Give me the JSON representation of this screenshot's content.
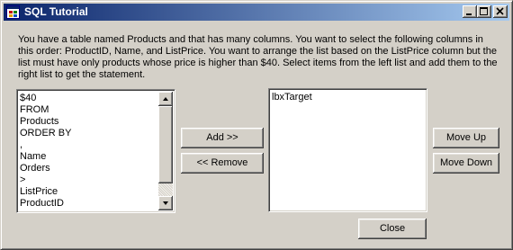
{
  "window": {
    "title": "SQL Tutorial",
    "icon": "app-icon",
    "controls": [
      "minimize-icon",
      "maximize-icon",
      "close-icon"
    ]
  },
  "instructions": "You have a table named Products and that has many columns. You want to select the following columns in this order: ProductID, Name, and ListPrice.   You want to arrange the list based on the ListPrice column but the list must have only products whose price is higher than $40. Select items from the left list and add them to the right list to get the statement.",
  "source_list": {
    "items": [
      "$40",
      "FROM",
      "Products",
      "ORDER BY",
      ",",
      "Name",
      "Orders",
      ">",
      "ListPrice",
      "ProductID"
    ]
  },
  "target_list": {
    "items": [
      "lbxTarget"
    ]
  },
  "buttons": {
    "add": "Add >>",
    "remove": "<< Remove",
    "move_up": "Move Up",
    "move_down": "Move Down",
    "close": "Close"
  }
}
